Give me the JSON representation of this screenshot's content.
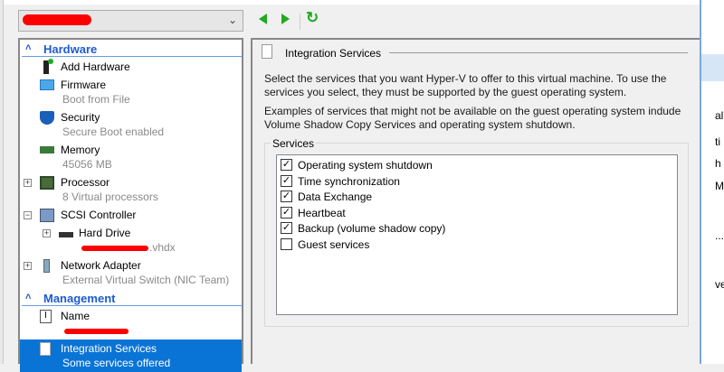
{
  "vm_selector": {
    "value_redacted": true
  },
  "toolbar": {
    "back": "back-arrow",
    "forward": "forward-arrow",
    "refresh": "refresh-icon"
  },
  "tree": {
    "hardware_header": "Hardware",
    "management_header": "Management",
    "items": [
      {
        "title": "Add Hardware",
        "subtitle": ""
      },
      {
        "title": "Firmware",
        "subtitle": "Boot from File"
      },
      {
        "title": "Security",
        "subtitle": "Secure Boot enabled"
      },
      {
        "title": "Memory",
        "subtitle": "45056 MB"
      },
      {
        "title": "Processor",
        "subtitle": "8 Virtual processors"
      },
      {
        "title": "SCSI Controller",
        "subtitle": ""
      },
      {
        "title": "Hard Drive",
        "subtitle": ".vhdx"
      },
      {
        "title": "Network Adapter",
        "subtitle": "External Virtual Switch (NIC Team)"
      },
      {
        "title": "Name",
        "subtitle": ""
      },
      {
        "title": "Integration Services",
        "subtitle": "Some services offered"
      }
    ]
  },
  "panel": {
    "title": "Integration Services",
    "para1_line1": "Select the services that you want Hyper-V to offer to this virtual machine. To use the",
    "para1_line2": "services you select, they must be supported by the guest operating system.",
    "para2_line1": "Examples of services that might not be available on the guest operating system indude",
    "para2_line2": "Volume Shadow Copy Services and operating system shutdown.",
    "group_label": "Services",
    "services": [
      {
        "label": "Operating system shutdown",
        "checked": true
      },
      {
        "label": "Time synchronization",
        "checked": true
      },
      {
        "label": "Data Exchange",
        "checked": true
      },
      {
        "label": "Heartbeat",
        "checked": true
      },
      {
        "label": "Backup (volume shadow copy)",
        "checked": true
      },
      {
        "label": "Guest services",
        "checked": false
      }
    ]
  },
  "background_window": {
    "fragments": [
      "al",
      "ti",
      "h",
      "M",
      "...",
      "ve"
    ]
  },
  "colors": {
    "selection": "#0a74d6",
    "section": "#1c5bd0",
    "nav": "#22aa22"
  }
}
